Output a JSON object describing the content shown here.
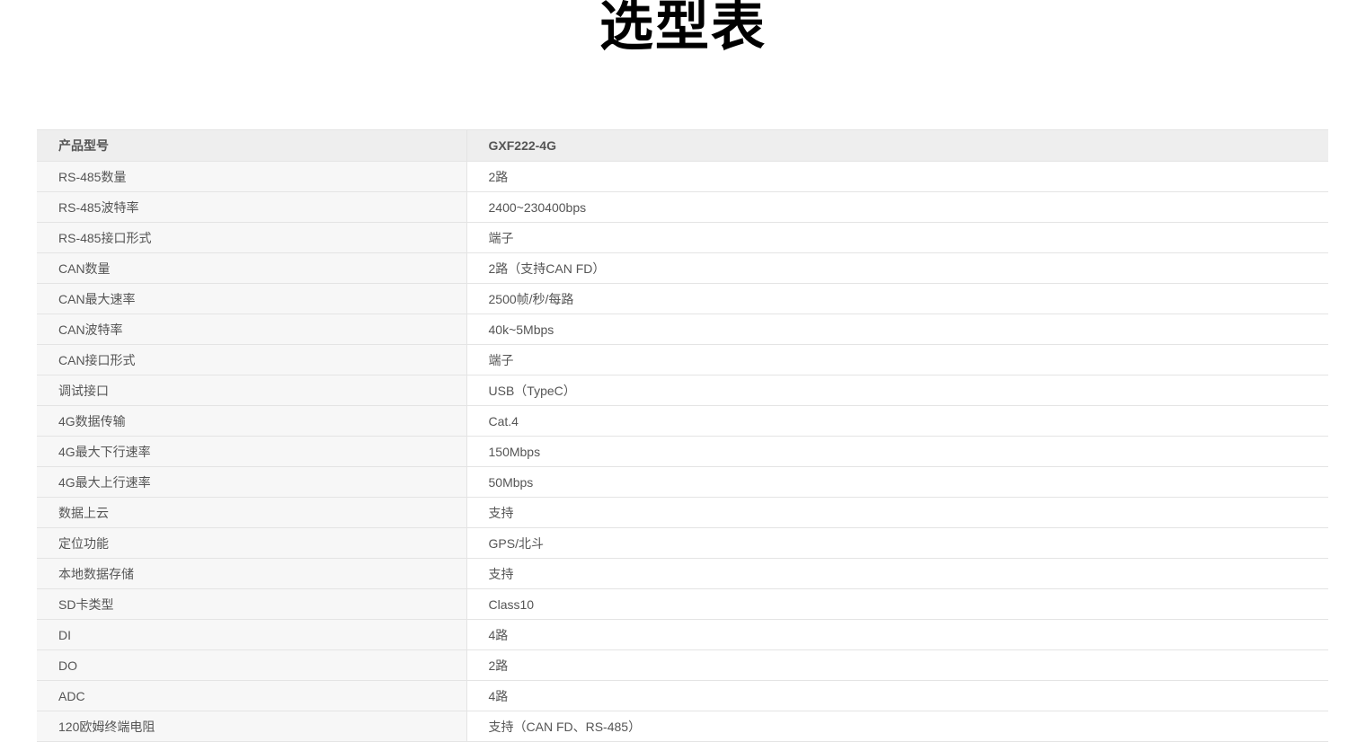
{
  "page": {
    "title": "选型表"
  },
  "table": {
    "header": {
      "label": "产品型号",
      "value": "GXF222-4G"
    },
    "rows": [
      {
        "label": "RS-485数量",
        "value": "2路"
      },
      {
        "label": "RS-485波特率",
        "value": "2400~230400bps"
      },
      {
        "label": "RS-485接口形式",
        "value": "端子"
      },
      {
        "label": "CAN数量",
        "value": "2路（支持CAN FD）"
      },
      {
        "label": "CAN最大速率",
        "value": "2500帧/秒/每路"
      },
      {
        "label": "CAN波特率",
        "value": "40k~5Mbps"
      },
      {
        "label": "CAN接口形式",
        "value": "端子"
      },
      {
        "label": "调试接口",
        "value": "USB（TypeC）"
      },
      {
        "label": "4G数据传输",
        "value": "Cat.4"
      },
      {
        "label": "4G最大下行速率",
        "value": "150Mbps"
      },
      {
        "label": "4G最大上行速率",
        "value": "50Mbps"
      },
      {
        "label": "数据上云",
        "value": "支持"
      },
      {
        "label": "定位功能",
        "value": "GPS/北斗"
      },
      {
        "label": "本地数据存储",
        "value": "支持"
      },
      {
        "label": "SD卡类型",
        "value": "Class10"
      },
      {
        "label": "DI",
        "value": "4路"
      },
      {
        "label": "DO",
        "value": "2路"
      },
      {
        "label": "ADC",
        "value": "4路"
      },
      {
        "label": "120欧姆终端电阻",
        "value": "支持（CAN FD、RS-485）"
      }
    ]
  }
}
